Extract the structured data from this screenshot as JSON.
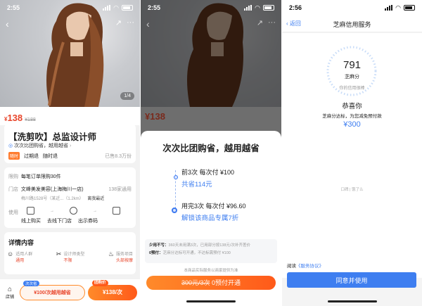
{
  "screen1": {
    "status": {
      "time": "2:55"
    },
    "hero": {
      "page_indicator": "1/4"
    },
    "price": {
      "symbol": "¥",
      "value": "138",
      "original": "¥188"
    },
    "title": "【洗剪吹】总监设计师",
    "group_line": "次次比团购省，越用越省",
    "tags": {
      "badge": "随时",
      "expire": "过期退",
      "anytime": "随时退",
      "sold": "已售8.3万份"
    },
    "limit": {
      "label": "限购",
      "value": "每笔订单限购30件"
    },
    "store": {
      "label": "门店",
      "name": "文峰美发美容(上海梅川一店)",
      "count": "138家通用",
      "address": "梅川路1528号（某近...（1.2km）",
      "distance": "离我最近"
    },
    "use": {
      "label": "使用",
      "steps": [
        "线上购买",
        "去线下门店",
        "出示券码"
      ]
    },
    "details": {
      "title": "详情内容",
      "cols": [
        {
          "label": "适用人群",
          "value": "通用"
        },
        {
          "label": "设计师类型",
          "value": "不限"
        },
        {
          "label": "服务项目",
          "value": "头部按摩"
        }
      ]
    },
    "bottom": {
      "store_label": "店铺",
      "member_tag": "次次省",
      "member_price": "¥100/次越用越省",
      "group_tag": "团购价",
      "group_price": "¥138/次"
    }
  },
  "screen2": {
    "status": {
      "time": "2:55"
    },
    "sheet_title": "次次比团购省，越用越省",
    "step1": {
      "title": "前3次  每次付 ¥100",
      "sub": "共省114元"
    },
    "step2": {
      "title": "用完3次  每次付 ¥96.60",
      "sub": "解锁该商品专属7折"
    },
    "rules": [
      {
        "label": "少用不亏：",
        "text": "360天未用满3次，已用部分按138元/次补齐差价"
      },
      {
        "label": "0预付：",
        "text": "芝麻分达标可开通，不达标需预付 ¥100"
      }
    ],
    "note": "本商品实际服务以商家提供为准",
    "button": {
      "strike": "300元/3次",
      "text": "0预付开通"
    },
    "bg_price": "¥138"
  },
  "screen3": {
    "status": {
      "time": "2:56"
    },
    "nav": {
      "back": "返回",
      "title": "芝麻信用服务"
    },
    "score": {
      "value": "791",
      "label": "芝麻分",
      "desc": "你的信用很棒"
    },
    "congrats": "恭喜你",
    "sub": "芝麻分达标，为您减免预付款",
    "amount": "¥300",
    "logos": [
      "口碑",
      "饿了么"
    ],
    "agreement": {
      "prefix": "阅读",
      "link": "《服务协议》"
    },
    "agree_button": "同意并使用"
  }
}
